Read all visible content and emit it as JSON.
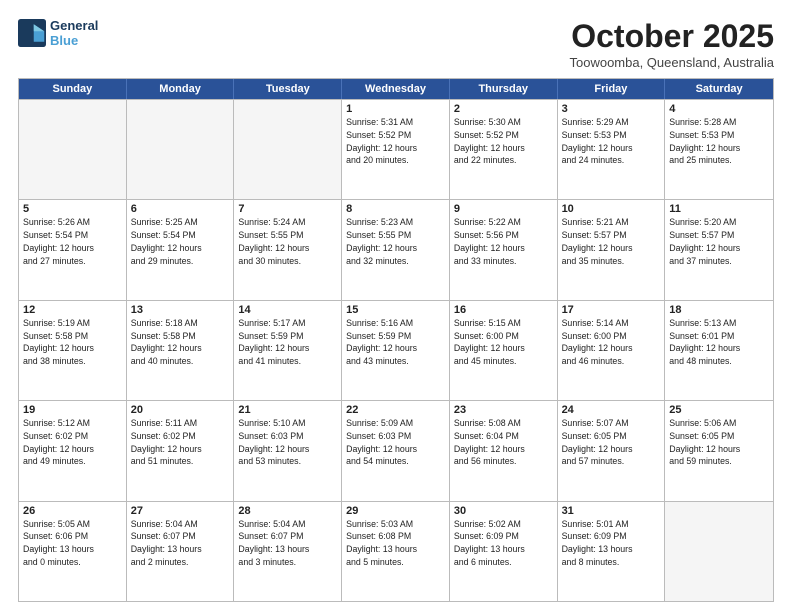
{
  "header": {
    "logo_line1": "General",
    "logo_line2": "Blue",
    "month": "October 2025",
    "location": "Toowoomba, Queensland, Australia"
  },
  "weekdays": [
    "Sunday",
    "Monday",
    "Tuesday",
    "Wednesday",
    "Thursday",
    "Friday",
    "Saturday"
  ],
  "rows": [
    [
      {
        "day": "",
        "info": ""
      },
      {
        "day": "",
        "info": ""
      },
      {
        "day": "",
        "info": ""
      },
      {
        "day": "1",
        "info": "Sunrise: 5:31 AM\nSunset: 5:52 PM\nDaylight: 12 hours\nand 20 minutes."
      },
      {
        "day": "2",
        "info": "Sunrise: 5:30 AM\nSunset: 5:52 PM\nDaylight: 12 hours\nand 22 minutes."
      },
      {
        "day": "3",
        "info": "Sunrise: 5:29 AM\nSunset: 5:53 PM\nDaylight: 12 hours\nand 24 minutes."
      },
      {
        "day": "4",
        "info": "Sunrise: 5:28 AM\nSunset: 5:53 PM\nDaylight: 12 hours\nand 25 minutes."
      }
    ],
    [
      {
        "day": "5",
        "info": "Sunrise: 5:26 AM\nSunset: 5:54 PM\nDaylight: 12 hours\nand 27 minutes."
      },
      {
        "day": "6",
        "info": "Sunrise: 5:25 AM\nSunset: 5:54 PM\nDaylight: 12 hours\nand 29 minutes."
      },
      {
        "day": "7",
        "info": "Sunrise: 5:24 AM\nSunset: 5:55 PM\nDaylight: 12 hours\nand 30 minutes."
      },
      {
        "day": "8",
        "info": "Sunrise: 5:23 AM\nSunset: 5:55 PM\nDaylight: 12 hours\nand 32 minutes."
      },
      {
        "day": "9",
        "info": "Sunrise: 5:22 AM\nSunset: 5:56 PM\nDaylight: 12 hours\nand 33 minutes."
      },
      {
        "day": "10",
        "info": "Sunrise: 5:21 AM\nSunset: 5:57 PM\nDaylight: 12 hours\nand 35 minutes."
      },
      {
        "day": "11",
        "info": "Sunrise: 5:20 AM\nSunset: 5:57 PM\nDaylight: 12 hours\nand 37 minutes."
      }
    ],
    [
      {
        "day": "12",
        "info": "Sunrise: 5:19 AM\nSunset: 5:58 PM\nDaylight: 12 hours\nand 38 minutes."
      },
      {
        "day": "13",
        "info": "Sunrise: 5:18 AM\nSunset: 5:58 PM\nDaylight: 12 hours\nand 40 minutes."
      },
      {
        "day": "14",
        "info": "Sunrise: 5:17 AM\nSunset: 5:59 PM\nDaylight: 12 hours\nand 41 minutes."
      },
      {
        "day": "15",
        "info": "Sunrise: 5:16 AM\nSunset: 5:59 PM\nDaylight: 12 hours\nand 43 minutes."
      },
      {
        "day": "16",
        "info": "Sunrise: 5:15 AM\nSunset: 6:00 PM\nDaylight: 12 hours\nand 45 minutes."
      },
      {
        "day": "17",
        "info": "Sunrise: 5:14 AM\nSunset: 6:00 PM\nDaylight: 12 hours\nand 46 minutes."
      },
      {
        "day": "18",
        "info": "Sunrise: 5:13 AM\nSunset: 6:01 PM\nDaylight: 12 hours\nand 48 minutes."
      }
    ],
    [
      {
        "day": "19",
        "info": "Sunrise: 5:12 AM\nSunset: 6:02 PM\nDaylight: 12 hours\nand 49 minutes."
      },
      {
        "day": "20",
        "info": "Sunrise: 5:11 AM\nSunset: 6:02 PM\nDaylight: 12 hours\nand 51 minutes."
      },
      {
        "day": "21",
        "info": "Sunrise: 5:10 AM\nSunset: 6:03 PM\nDaylight: 12 hours\nand 53 minutes."
      },
      {
        "day": "22",
        "info": "Sunrise: 5:09 AM\nSunset: 6:03 PM\nDaylight: 12 hours\nand 54 minutes."
      },
      {
        "day": "23",
        "info": "Sunrise: 5:08 AM\nSunset: 6:04 PM\nDaylight: 12 hours\nand 56 minutes."
      },
      {
        "day": "24",
        "info": "Sunrise: 5:07 AM\nSunset: 6:05 PM\nDaylight: 12 hours\nand 57 minutes."
      },
      {
        "day": "25",
        "info": "Sunrise: 5:06 AM\nSunset: 6:05 PM\nDaylight: 12 hours\nand 59 minutes."
      }
    ],
    [
      {
        "day": "26",
        "info": "Sunrise: 5:05 AM\nSunset: 6:06 PM\nDaylight: 13 hours\nand 0 minutes."
      },
      {
        "day": "27",
        "info": "Sunrise: 5:04 AM\nSunset: 6:07 PM\nDaylight: 13 hours\nand 2 minutes."
      },
      {
        "day": "28",
        "info": "Sunrise: 5:04 AM\nSunset: 6:07 PM\nDaylight: 13 hours\nand 3 minutes."
      },
      {
        "day": "29",
        "info": "Sunrise: 5:03 AM\nSunset: 6:08 PM\nDaylight: 13 hours\nand 5 minutes."
      },
      {
        "day": "30",
        "info": "Sunrise: 5:02 AM\nSunset: 6:09 PM\nDaylight: 13 hours\nand 6 minutes."
      },
      {
        "day": "31",
        "info": "Sunrise: 5:01 AM\nSunset: 6:09 PM\nDaylight: 13 hours\nand 8 minutes."
      },
      {
        "day": "",
        "info": ""
      }
    ]
  ]
}
